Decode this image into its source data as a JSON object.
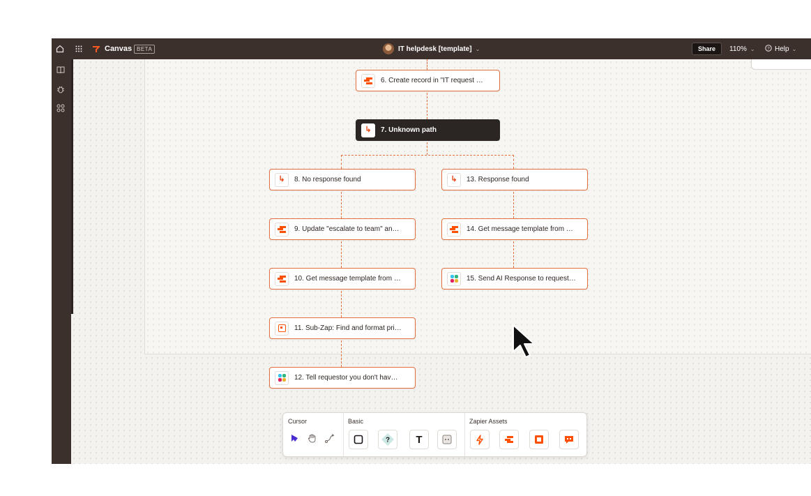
{
  "app": {
    "name": "Canvas",
    "badge": "BETA",
    "doc_title": "IT helpdesk [template]",
    "share_label": "Share",
    "zoom": "110%",
    "help_label": "Help"
  },
  "icons": {
    "home": "home-icon",
    "apps": "grid-icon",
    "doc_menu": "chevron-down-icon",
    "help": "help-circle-icon",
    "sidebar": [
      "book-icon",
      "bug-icon",
      "components-icon"
    ]
  },
  "colors": {
    "accent": "#ff4f00",
    "connector": "#e2703e",
    "topbar": "#3b302c",
    "selected_step": "#2b2624"
  },
  "steps": [
    {
      "label": "6. Create record in \"IT request …",
      "icon": "tables-icon"
    },
    {
      "label": "7. Unknown path",
      "icon": "path-icon",
      "selected": true
    },
    {
      "label": "8. No response found",
      "icon": "path-icon"
    },
    {
      "label": "13. Response found",
      "icon": "path-icon"
    },
    {
      "label": "9. Update \"escalate to team\" an…",
      "icon": "tables-icon"
    },
    {
      "label": "14. Get message template from …",
      "icon": "tables-icon"
    },
    {
      "label": "10. Get message template from …",
      "icon": "tables-icon"
    },
    {
      "label": "15. Send AI Response to request…",
      "icon": "slack-icon"
    },
    {
      "label": "11. Sub-Zap: Find and format pri…",
      "icon": "sub-zap-icon"
    },
    {
      "label": "12. Tell requestor you don't hav…",
      "icon": "slack-icon"
    }
  ],
  "toolbar": {
    "sections": [
      {
        "title": "Cursor",
        "tools": [
          "select-tool",
          "hand-tool",
          "connector-tool"
        ]
      },
      {
        "title": "Basic",
        "tools": [
          "rectangle-tool",
          "diamond-tool",
          "text-tool",
          "sticky-tool"
        ]
      },
      {
        "title": "Zapier Assets",
        "tools": [
          "zap-tool",
          "tables-tool",
          "interface-tool",
          "chatbot-tool"
        ]
      }
    ],
    "text_tool_glyph": "T",
    "diamond_glyph": "?"
  }
}
